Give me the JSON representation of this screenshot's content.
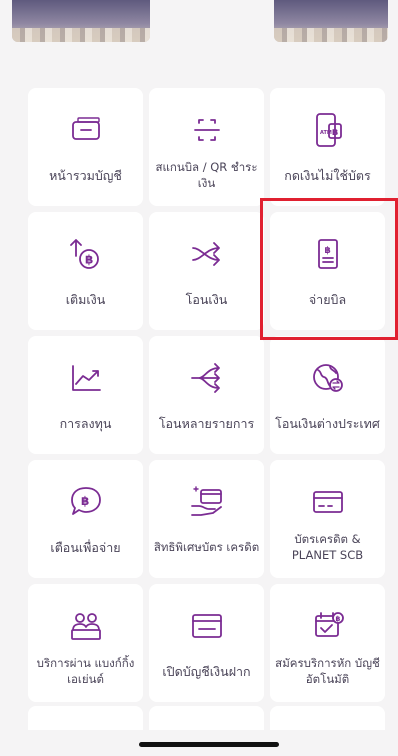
{
  "menu": {
    "tiles": [
      {
        "id": "account-summary",
        "label": "หน้ารวมบัญชี",
        "icon": "wallet-card-icon"
      },
      {
        "id": "scan-qr",
        "label": "สแกนบิล / QR ชำระเงิน",
        "icon": "scan-frame-icon"
      },
      {
        "id": "cardless-withdraw",
        "label": "กดเงินไม่ใช้บัตร",
        "icon": "atm-phone-icon"
      },
      {
        "id": "top-up",
        "label": "เติมเงิน",
        "icon": "baht-topup-icon"
      },
      {
        "id": "transfer",
        "label": "โอนเงิน",
        "icon": "shuffle-arrows-icon"
      },
      {
        "id": "pay-bill",
        "label": "จ่ายบิล",
        "icon": "bill-receipt-icon"
      },
      {
        "id": "invest",
        "label": "การลงทุน",
        "icon": "chart-trend-icon"
      },
      {
        "id": "multi-transfer",
        "label": "โอนหลายรายการ",
        "icon": "multi-arrows-icon"
      },
      {
        "id": "international-transfer",
        "label": "โอนเงินต่างประเทศ",
        "icon": "globe-exchange-icon"
      },
      {
        "id": "payment-reminder",
        "label": "เตือนเพื่อจ่าย",
        "icon": "baht-chat-icon"
      },
      {
        "id": "credit-card-privileges",
        "label": "สิทธิพิเศษบัตร เครดิต",
        "icon": "card-hand-icon"
      },
      {
        "id": "credit-card-planet",
        "label": "บัตรเครดิต & PLANET SCB",
        "icon": "credit-card-icon"
      },
      {
        "id": "agent-banking",
        "label": "บริการผ่าน แบงก์กิ้งเอเย่นต์",
        "icon": "agent-people-icon"
      },
      {
        "id": "open-deposit",
        "label": "เปิดบัญชีเงินฝาก",
        "icon": "wallet-open-icon"
      },
      {
        "id": "auto-debit",
        "label": "สมัครบริการหัก บัญชีอัตโนมัติ",
        "icon": "calendar-check-icon"
      }
    ]
  },
  "icon_text": {
    "atm": "ATM",
    "baht": "฿"
  },
  "colors": {
    "accent": "#7b2c93",
    "highlight": "#e02030",
    "background": "#f5f4f5",
    "tile": "#ffffff"
  }
}
